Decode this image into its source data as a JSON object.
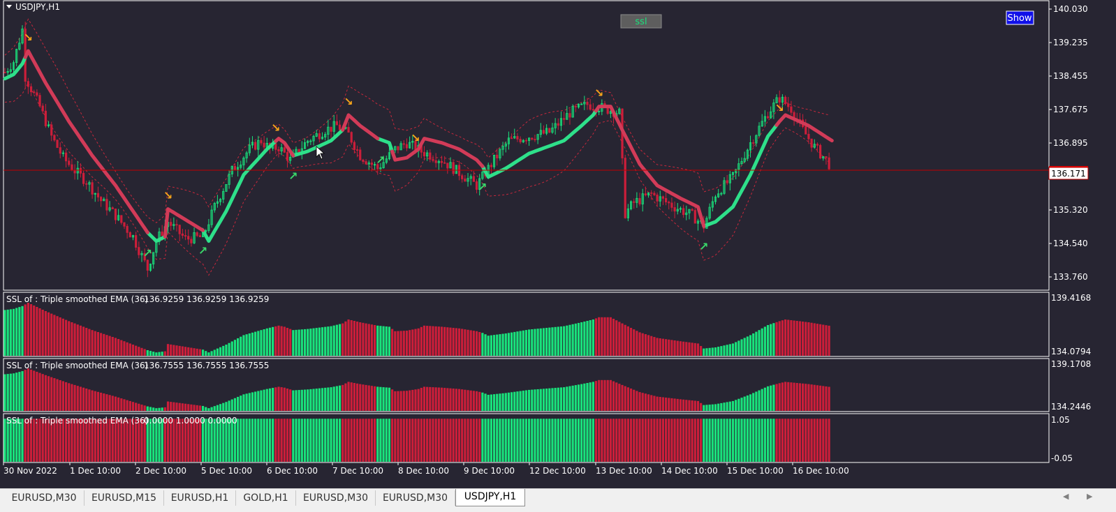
{
  "window": {
    "symbol_title": "USDJPY,H1"
  },
  "colors": {
    "background": "#272532",
    "grid_text": "#ffffff",
    "bull": "#19e27c",
    "bear": "#cc1e3a",
    "ssl_up": "#2ee08a",
    "ssl_down": "#d23b58",
    "band": "#c8283c",
    "arrow_up": "#3ad86a",
    "arrow_down": "#f5a31a",
    "price_line": "#c00000"
  },
  "buttons": {
    "ssl_label": "ssl",
    "show_label": "Show"
  },
  "current_price": "136.171",
  "chart_data": [
    {
      "type": "candlestick",
      "title": "USDJPY,H1",
      "y_ticks": [
        "140.030",
        "139.235",
        "138.455",
        "137.675",
        "136.895",
        "136.115",
        "135.320",
        "134.540",
        "133.760"
      ],
      "ylim": [
        133.48,
        140.18
      ],
      "x_tick_labels": [
        "30 Nov 2022",
        "1 Dec 10:00",
        "2 Dec 10:00",
        "5 Dec 10:00",
        "6 Dec 10:00",
        "7 Dec 10:00",
        "8 Dec 10:00",
        "9 Dec 10:00",
        "12 Dec 10:00",
        "13 Dec 10:00",
        "14 Dec 10:00",
        "15 Dec 10:00",
        "16 Dec 10:00"
      ],
      "bar_count": 200,
      "close_path_keypoints": [
        [
          0,
          138.55
        ],
        [
          3,
          138.8
        ],
        [
          6,
          139.55
        ],
        [
          7,
          138.45
        ],
        [
          12,
          137.75
        ],
        [
          16,
          137.05
        ],
        [
          20,
          136.55
        ],
        [
          24,
          136.25
        ],
        [
          28,
          136.0
        ],
        [
          33,
          135.55
        ],
        [
          38,
          135.2
        ],
        [
          44,
          134.7
        ],
        [
          49,
          133.95
        ],
        [
          52,
          134.6
        ],
        [
          56,
          135.05
        ],
        [
          62,
          134.65
        ],
        [
          68,
          134.7
        ],
        [
          72,
          135.4
        ],
        [
          78,
          136.25
        ],
        [
          84,
          136.75
        ],
        [
          88,
          136.95
        ],
        [
          91,
          136.75
        ],
        [
          94,
          136.8
        ],
        [
          98,
          136.5
        ],
        [
          104,
          136.95
        ],
        [
          110,
          137.2
        ],
        [
          114,
          137.3
        ],
        [
          118,
          137.1
        ],
        [
          122,
          136.6
        ],
        [
          128,
          136.3
        ],
        [
          134,
          136.75
        ],
        [
          138,
          136.9
        ],
        [
          143,
          136.7
        ],
        [
          150,
          136.5
        ],
        [
          156,
          136.2
        ],
        [
          162,
          135.9
        ],
        [
          168,
          136.5
        ],
        [
          173,
          136.95
        ],
        [
          180,
          137.05
        ],
        [
          187,
          137.15
        ],
        [
          194,
          137.6
        ],
        [
          200,
          137.8
        ],
        [
          206,
          137.7
        ],
        [
          211,
          137.6
        ],
        [
          213,
          135.25
        ],
        [
          216,
          135.5
        ],
        [
          222,
          135.7
        ],
        [
          230,
          135.4
        ],
        [
          236,
          135.2
        ],
        [
          240,
          134.95
        ],
        [
          244,
          135.7
        ],
        [
          250,
          136.1
        ],
        [
          256,
          136.9
        ],
        [
          262,
          137.6
        ],
        [
          266,
          137.95
        ],
        [
          270,
          137.7
        ],
        [
          274,
          137.2
        ],
        [
          278,
          136.8
        ],
        [
          282,
          136.5
        ],
        [
          284,
          136.3
        ]
      ],
      "ssl_keypoints": [
        [
          0,
          138.4
        ],
        [
          3,
          138.5
        ],
        [
          6,
          138.75
        ],
        [
          8,
          139.05
        ],
        [
          14,
          138.3
        ],
        [
          22,
          137.4
        ],
        [
          30,
          136.6
        ],
        [
          38,
          135.9
        ],
        [
          44,
          135.3
        ],
        [
          49,
          134.8
        ],
        [
          52,
          134.6
        ],
        [
          55,
          134.7
        ],
        [
          56,
          135.35
        ],
        [
          62,
          135.1
        ],
        [
          68,
          134.85
        ],
        [
          70,
          134.6
        ],
        [
          76,
          135.3
        ],
        [
          82,
          136.15
        ],
        [
          90,
          136.75
        ],
        [
          94,
          137.0
        ],
        [
          96,
          136.9
        ],
        [
          99,
          136.6
        ],
        [
          104,
          136.7
        ],
        [
          112,
          136.95
        ],
        [
          116,
          137.2
        ],
        [
          118,
          137.55
        ],
        [
          122,
          137.3
        ],
        [
          128,
          137.0
        ],
        [
          132,
          136.9
        ],
        [
          134,
          136.5
        ],
        [
          138,
          136.55
        ],
        [
          142,
          136.75
        ],
        [
          144,
          137.0
        ],
        [
          150,
          136.9
        ],
        [
          156,
          136.75
        ],
        [
          162,
          136.5
        ],
        [
          164,
          136.35
        ],
        [
          166,
          136.1
        ],
        [
          172,
          136.3
        ],
        [
          180,
          136.65
        ],
        [
          186,
          136.8
        ],
        [
          192,
          136.95
        ],
        [
          198,
          137.3
        ],
        [
          202,
          137.55
        ],
        [
          204,
          137.75
        ],
        [
          208,
          137.75
        ],
        [
          212,
          137.2
        ],
        [
          218,
          136.4
        ],
        [
          224,
          135.9
        ],
        [
          232,
          135.6
        ],
        [
          238,
          135.4
        ],
        [
          240,
          134.95
        ],
        [
          244,
          135.05
        ],
        [
          250,
          135.4
        ],
        [
          256,
          136.15
        ],
        [
          262,
          137.05
        ],
        [
          266,
          137.4
        ],
        [
          268,
          137.55
        ],
        [
          276,
          137.3
        ],
        [
          284,
          136.95
        ]
      ],
      "ssl_up_segments": [
        [
          0,
          7
        ],
        [
          49,
          55
        ],
        [
          68,
          93
        ],
        [
          99,
          116
        ],
        [
          128,
          133
        ],
        [
          164,
          203
        ],
        [
          240,
          265
        ]
      ],
      "ssl_down_segments": [
        [
          7,
          49
        ],
        [
          55,
          68
        ],
        [
          93,
          99
        ],
        [
          116,
          128
        ],
        [
          133,
          164
        ],
        [
          203,
          240
        ],
        [
          265,
          284
        ]
      ],
      "buy_arrow_bars": [
        49,
        68,
        99,
        129,
        164,
        240
      ],
      "sell_arrow_bars": [
        8,
        56,
        93,
        118,
        141,
        204,
        266
      ]
    },
    {
      "type": "bar",
      "title": "SSL of : Triple smoothed EMA (36)",
      "legend_values": "136.9259 136.9259 136.9259",
      "y_max_label": "139.4168",
      "y_min_label": "134.0794"
    },
    {
      "type": "bar",
      "title": "SSL of : Triple smoothed EMA (36)",
      "legend_values": "136.7555 136.7555 136.7555",
      "y_max_label": "139.1708",
      "y_min_label": "134.2446"
    },
    {
      "type": "bar",
      "title": "SSL of : Triple smoothed EMA (36)",
      "legend_values": "0.0000 1.0000 0.0000",
      "y_max_label": "1.05",
      "y_min_label": "-0.05",
      "values": "1 = up, 0 = down by SSL direction"
    }
  ],
  "tabs": [
    {
      "label": "EURUSD,M30",
      "active": false
    },
    {
      "label": "EURUSD,M15",
      "active": false
    },
    {
      "label": "EURUSD,H1",
      "active": false
    },
    {
      "label": "GOLD,H1",
      "active": false
    },
    {
      "label": "EURUSD,M30",
      "active": false
    },
    {
      "label": "EURUSD,M30",
      "active": false
    },
    {
      "label": "USDJPY,H1",
      "active": true
    }
  ]
}
